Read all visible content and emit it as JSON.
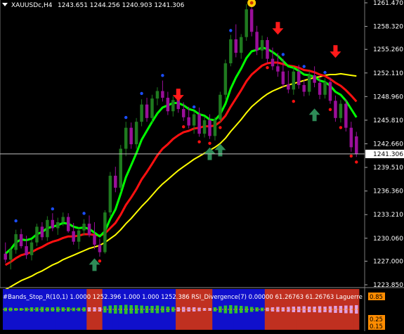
{
  "colors": {
    "background": "#000000",
    "axis_text": "#ffffff",
    "grid": "#2a2a2a",
    "bull_candle": "#1f7a1f",
    "bear_candle": "#9a0f9a",
    "fast_ma": "#00ff00",
    "mid_ma": "#ff1010",
    "slow_ma": "#ffff00",
    "fractal_up": "#1a4dff",
    "fractal_down": "#ff1010",
    "sell_arrow": "#ff1a1a",
    "buy_arrow": "#2e8b57",
    "price_line": "#c0c0c0",
    "indicator_blue": "#1010cc",
    "indicator_red": "#c03020"
  },
  "header": {
    "symbol_timeframe": "XAUUSDc,H4",
    "ohlc": "1243.651 1244.256 1240.903 1241.306",
    "menu_icon": "down-triangle-icon"
  },
  "current_price_label": "1241.306",
  "subwindow": {
    "label": "#Bands_Stop_R(10,1) 1.0000 1252.396 1.000 1.000 1252.386  RSI_Divergence(7) 0.00000  61.26763  61.26763  Laguerre",
    "axis_labels": [
      "0.85",
      "0.25",
      "0.15"
    ]
  },
  "chart_data": {
    "type": "candlestick",
    "y_axis_ticks": [
      "1261.470",
      "1258.320",
      "1255.260",
      "1252.110",
      "1248.960",
      "1245.810",
      "1242.660",
      "1239.510",
      "1236.360",
      "1233.210",
      "1230.060",
      "1227.000",
      "1223.850"
    ],
    "ylim": [
      1223.85,
      1261.47
    ],
    "candles": [
      [
        1228.0,
        1229.5,
        1226.8,
        1227.2
      ],
      [
        1227.2,
        1228.8,
        1225.9,
        1228.5
      ],
      [
        1228.5,
        1231.2,
        1228.0,
        1230.6
      ],
      [
        1230.6,
        1231.3,
        1228.7,
        1229.0
      ],
      [
        1229.0,
        1230.4,
        1227.3,
        1227.8
      ],
      [
        1227.8,
        1229.9,
        1227.1,
        1229.5
      ],
      [
        1229.5,
        1232.0,
        1229.0,
        1231.6
      ],
      [
        1231.6,
        1232.2,
        1229.8,
        1230.2
      ],
      [
        1230.2,
        1233.0,
        1229.7,
        1232.5
      ],
      [
        1232.5,
        1233.4,
        1231.0,
        1231.4
      ],
      [
        1231.4,
        1232.8,
        1230.5,
        1232.2
      ],
      [
        1232.2,
        1233.5,
        1231.7,
        1232.9
      ],
      [
        1232.9,
        1233.4,
        1230.8,
        1231.0
      ],
      [
        1231.0,
        1232.1,
        1229.2,
        1229.6
      ],
      [
        1229.6,
        1231.5,
        1228.6,
        1231.1
      ],
      [
        1231.1,
        1232.6,
        1230.4,
        1232.0
      ],
      [
        1232.0,
        1233.1,
        1230.2,
        1230.5
      ],
      [
        1230.5,
        1232.2,
        1228.6,
        1229.2
      ],
      [
        1229.2,
        1230.0,
        1227.6,
        1228.2
      ],
      [
        1228.2,
        1233.8,
        1228.0,
        1233.5
      ],
      [
        1233.5,
        1238.9,
        1233.0,
        1238.4
      ],
      [
        1238.4,
        1239.6,
        1236.2,
        1236.8
      ],
      [
        1236.8,
        1242.5,
        1236.2,
        1242.0
      ],
      [
        1242.0,
        1245.6,
        1241.0,
        1244.8
      ],
      [
        1244.8,
        1245.5,
        1242.0,
        1242.6
      ],
      [
        1242.6,
        1246.1,
        1242.0,
        1245.6
      ],
      [
        1245.6,
        1248.6,
        1245.0,
        1247.9
      ],
      [
        1247.9,
        1248.8,
        1245.6,
        1246.1
      ],
      [
        1246.1,
        1249.2,
        1245.5,
        1248.7
      ],
      [
        1248.7,
        1250.2,
        1247.8,
        1249.7
      ],
      [
        1249.7,
        1251.1,
        1248.3,
        1248.8
      ],
      [
        1248.8,
        1249.6,
        1246.5,
        1247.0
      ],
      [
        1247.0,
        1249.0,
        1246.3,
        1248.5
      ],
      [
        1248.5,
        1249.8,
        1246.8,
        1247.3
      ],
      [
        1247.3,
        1248.2,
        1245.7,
        1246.2
      ],
      [
        1246.2,
        1247.6,
        1244.7,
        1245.1
      ],
      [
        1245.1,
        1247.0,
        1244.0,
        1246.6
      ],
      [
        1246.6,
        1247.5,
        1243.6,
        1244.0
      ],
      [
        1244.0,
        1246.3,
        1243.5,
        1245.8
      ],
      [
        1245.8,
        1246.6,
        1243.3,
        1243.7
      ],
      [
        1243.7,
        1246.2,
        1243.1,
        1245.9
      ],
      [
        1245.9,
        1249.6,
        1245.5,
        1249.2
      ],
      [
        1249.2,
        1253.9,
        1248.6,
        1253.4
      ],
      [
        1253.4,
        1257.2,
        1253.0,
        1256.6
      ],
      [
        1256.6,
        1258.6,
        1254.2,
        1254.8
      ],
      [
        1254.8,
        1257.3,
        1254.0,
        1256.9
      ],
      [
        1256.9,
        1261.3,
        1256.4,
        1260.6
      ],
      [
        1260.6,
        1261.0,
        1257.0,
        1257.6
      ],
      [
        1257.6,
        1258.4,
        1254.5,
        1255.1
      ],
      [
        1255.1,
        1257.1,
        1254.0,
        1256.5
      ],
      [
        1256.5,
        1256.9,
        1253.4,
        1254.0
      ],
      [
        1254.0,
        1255.5,
        1252.5,
        1253.0
      ],
      [
        1253.0,
        1254.8,
        1251.6,
        1252.3
      ],
      [
        1252.3,
        1254.0,
        1250.1,
        1250.6
      ],
      [
        1250.6,
        1252.4,
        1249.4,
        1249.9
      ],
      [
        1249.9,
        1252.9,
        1249.2,
        1252.3
      ],
      [
        1252.3,
        1253.2,
        1250.0,
        1250.5
      ],
      [
        1250.5,
        1251.2,
        1249.0,
        1249.6
      ],
      [
        1249.6,
        1252.4,
        1249.1,
        1251.8
      ],
      [
        1251.8,
        1253.0,
        1250.2,
        1250.8
      ],
      [
        1250.8,
        1251.6,
        1248.6,
        1249.2
      ],
      [
        1249.2,
        1251.4,
        1248.7,
        1250.9
      ],
      [
        1250.9,
        1251.5,
        1248.0,
        1248.4
      ],
      [
        1248.4,
        1249.1,
        1245.6,
        1246.1
      ],
      [
        1246.1,
        1248.5,
        1245.5,
        1248.0
      ],
      [
        1248.0,
        1248.6,
        1244.3,
        1244.8
      ],
      [
        1244.8,
        1245.6,
        1241.6,
        1242.2
      ],
      [
        1243.651,
        1244.256,
        1240.903,
        1241.306
      ]
    ],
    "series": [
      {
        "name": "",
        "style": "fast",
        "values": [
          1228.0,
          1228.6,
          1229.5,
          1229.9,
          1229.8,
          1230.0,
          1230.6,
          1230.9,
          1231.4,
          1231.6,
          1231.8,
          1232.1,
          1232.0,
          1231.6,
          1231.4,
          1231.5,
          1231.3,
          1230.8,
          1230.3,
          1231.0,
          1232.6,
          1233.9,
          1236.0,
          1238.2,
          1239.8,
          1241.4,
          1243.2,
          1244.4,
          1245.6,
          1246.7,
          1247.5,
          1247.8,
          1248.1,
          1248.1,
          1247.8,
          1247.3,
          1247.1,
          1246.6,
          1246.4,
          1245.9,
          1245.8,
          1246.6,
          1248.0,
          1250.0,
          1251.5,
          1252.7,
          1254.1,
          1255.0,
          1255.2,
          1255.5,
          1255.3,
          1254.9,
          1254.4,
          1253.7,
          1253.0,
          1252.8,
          1252.4,
          1251.9,
          1251.8,
          1251.6,
          1251.1,
          1250.9,
          1250.4,
          1249.6,
          1249.2,
          1248.4,
          1247.3,
          1246.2
        ]
      },
      {
        "name": "",
        "style": "mid",
        "values": [
          1226.5,
          1226.9,
          1227.4,
          1227.8,
          1228.0,
          1228.2,
          1228.6,
          1228.9,
          1229.3,
          1229.6,
          1229.8,
          1230.1,
          1230.3,
          1230.3,
          1230.4,
          1230.6,
          1230.6,
          1230.5,
          1230.4,
          1230.7,
          1231.4,
          1232.1,
          1233.2,
          1234.5,
          1235.5,
          1236.6,
          1237.9,
          1238.9,
          1240.0,
          1241.1,
          1242.0,
          1242.6,
          1243.3,
          1243.8,
          1244.2,
          1244.4,
          1244.7,
          1244.8,
          1245.0,
          1245.0,
          1245.1,
          1245.6,
          1246.4,
          1247.6,
          1248.7,
          1249.8,
          1251.0,
          1251.9,
          1252.5,
          1253.1,
          1253.4,
          1253.5,
          1253.5,
          1253.3,
          1253.1,
          1253.0,
          1252.8,
          1252.5,
          1252.4,
          1252.2,
          1251.9,
          1251.7,
          1251.3,
          1250.8,
          1250.4,
          1249.8,
          1249.1,
          1248.3
        ]
      },
      {
        "name": "",
        "style": "slow",
        "values": [
          1223.2,
          1223.6,
          1224.0,
          1224.4,
          1224.7,
          1225.0,
          1225.4,
          1225.7,
          1226.1,
          1226.5,
          1226.8,
          1227.2,
          1227.5,
          1227.8,
          1228.1,
          1228.4,
          1228.7,
          1228.9,
          1229.1,
          1229.5,
          1230.0,
          1230.5,
          1231.2,
          1232.0,
          1232.7,
          1233.5,
          1234.3,
          1235.0,
          1235.8,
          1236.6,
          1237.3,
          1237.9,
          1238.5,
          1239.1,
          1239.6,
          1240.1,
          1240.6,
          1241.0,
          1241.4,
          1241.8,
          1242.2,
          1242.7,
          1243.4,
          1244.3,
          1245.1,
          1245.9,
          1246.8,
          1247.6,
          1248.2,
          1248.8,
          1249.3,
          1249.7,
          1250.0,
          1250.3,
          1250.5,
          1250.7,
          1250.9,
          1251.1,
          1251.3,
          1251.5,
          1251.6,
          1251.8,
          1251.9,
          1251.9,
          1252.0,
          1251.9,
          1251.8,
          1251.7
        ]
      }
    ],
    "fractals_up": [
      [
        2,
        1232.0
      ],
      [
        9,
        1233.6
      ],
      [
        15,
        1233.0
      ],
      [
        23,
        1245.8
      ],
      [
        26,
        1249.0
      ],
      [
        30,
        1251.4
      ],
      [
        36,
        1247.2
      ],
      [
        43,
        1257.4
      ],
      [
        47,
        1261.3
      ],
      [
        53,
        1254.2
      ],
      [
        57,
        1252.6
      ],
      [
        61,
        1251.8
      ]
    ],
    "fractals_down": [
      [
        18,
        1227.4
      ],
      [
        34,
        1245.3
      ],
      [
        37,
        1243.3
      ],
      [
        39,
        1243.1
      ],
      [
        41,
        1245.2
      ],
      [
        50,
        1253.2
      ],
      [
        55,
        1248.7
      ],
      [
        62,
        1247.6
      ],
      [
        64,
        1245.2
      ],
      [
        66,
        1241.4
      ],
      [
        67,
        1240.6
      ]
    ],
    "sell_signals": [
      [
        33,
        1248.7
      ],
      [
        52,
        1257.6
      ],
      [
        63,
        1254.5
      ]
    ],
    "buy_signals": [
      [
        17,
        1227.0
      ],
      [
        39,
        1241.8
      ],
      [
        41,
        1242.3
      ],
      [
        59,
        1247.0
      ]
    ],
    "top_marker_bar": 47,
    "histogram": [
      {
        "color": "blue",
        "h": 0.25
      },
      {
        "color": "blue",
        "h": 0.25
      },
      {
        "color": "blue",
        "h": 0.2
      },
      {
        "color": "blue",
        "h": 0.2
      },
      {
        "color": "blue",
        "h": 0.25
      },
      {
        "color": "blue",
        "h": 0.3
      },
      {
        "color": "blue",
        "h": 0.3
      },
      {
        "color": "blue",
        "h": 0.35
      },
      {
        "color": "blue",
        "h": 0.3
      },
      {
        "color": "blue",
        "h": 0.3
      },
      {
        "color": "blue",
        "h": 0.35
      },
      {
        "color": "blue",
        "h": 0.3
      },
      {
        "color": "blue",
        "h": 0.3
      },
      {
        "color": "blue",
        "h": 0.25
      },
      {
        "color": "blue",
        "h": 0.25
      },
      {
        "color": "blue",
        "h": 0.3
      },
      {
        "color": "red",
        "h": 0.3
      },
      {
        "color": "red",
        "h": 0.3
      },
      {
        "color": "red",
        "h": 0.3
      },
      {
        "color": "blue",
        "h": 0.45
      },
      {
        "color": "blue",
        "h": 0.55
      },
      {
        "color": "blue",
        "h": 0.6
      },
      {
        "color": "blue",
        "h": 0.6
      },
      {
        "color": "blue",
        "h": 0.65
      },
      {
        "color": "blue",
        "h": 0.6
      },
      {
        "color": "blue",
        "h": 0.6
      },
      {
        "color": "blue",
        "h": 0.55
      },
      {
        "color": "blue",
        "h": 0.5
      },
      {
        "color": "blue",
        "h": 0.5
      },
      {
        "color": "blue",
        "h": 0.55
      },
      {
        "color": "blue",
        "h": 0.45
      },
      {
        "color": "blue",
        "h": 0.4
      },
      {
        "color": "blue",
        "h": 0.35
      },
      {
        "color": "red",
        "h": 0.3
      },
      {
        "color": "red",
        "h": 0.35
      },
      {
        "color": "red",
        "h": 0.3
      },
      {
        "color": "red",
        "h": 0.3
      },
      {
        "color": "red",
        "h": 0.25
      },
      {
        "color": "red",
        "h": 0.2
      },
      {
        "color": "red",
        "h": 0.2
      },
      {
        "color": "blue",
        "h": 0.3
      },
      {
        "color": "blue",
        "h": 0.45
      },
      {
        "color": "blue",
        "h": 0.55
      },
      {
        "color": "blue",
        "h": 0.6
      },
      {
        "color": "blue",
        "h": 0.55
      },
      {
        "color": "blue",
        "h": 0.5
      },
      {
        "color": "blue",
        "h": 0.45
      },
      {
        "color": "blue",
        "h": 0.35
      },
      {
        "color": "blue",
        "h": 0.3
      },
      {
        "color": "blue",
        "h": 0.25
      },
      {
        "color": "red",
        "h": 0.25
      },
      {
        "color": "red",
        "h": 0.3
      },
      {
        "color": "red",
        "h": 0.35
      },
      {
        "color": "red",
        "h": 0.3
      },
      {
        "color": "red",
        "h": 0.35
      },
      {
        "color": "red",
        "h": 0.4
      },
      {
        "color": "red",
        "h": 0.4
      },
      {
        "color": "red",
        "h": 0.45
      },
      {
        "color": "red",
        "h": 0.4
      },
      {
        "color": "red",
        "h": 0.4
      },
      {
        "color": "red",
        "h": 0.45
      },
      {
        "color": "red",
        "h": 0.4
      },
      {
        "color": "red",
        "h": 0.45
      },
      {
        "color": "red",
        "h": 0.5
      },
      {
        "color": "red",
        "h": 0.5
      },
      {
        "color": "red",
        "h": 0.55
      },
      {
        "color": "red",
        "h": 0.55
      },
      {
        "color": "red",
        "h": 0.6
      }
    ]
  }
}
